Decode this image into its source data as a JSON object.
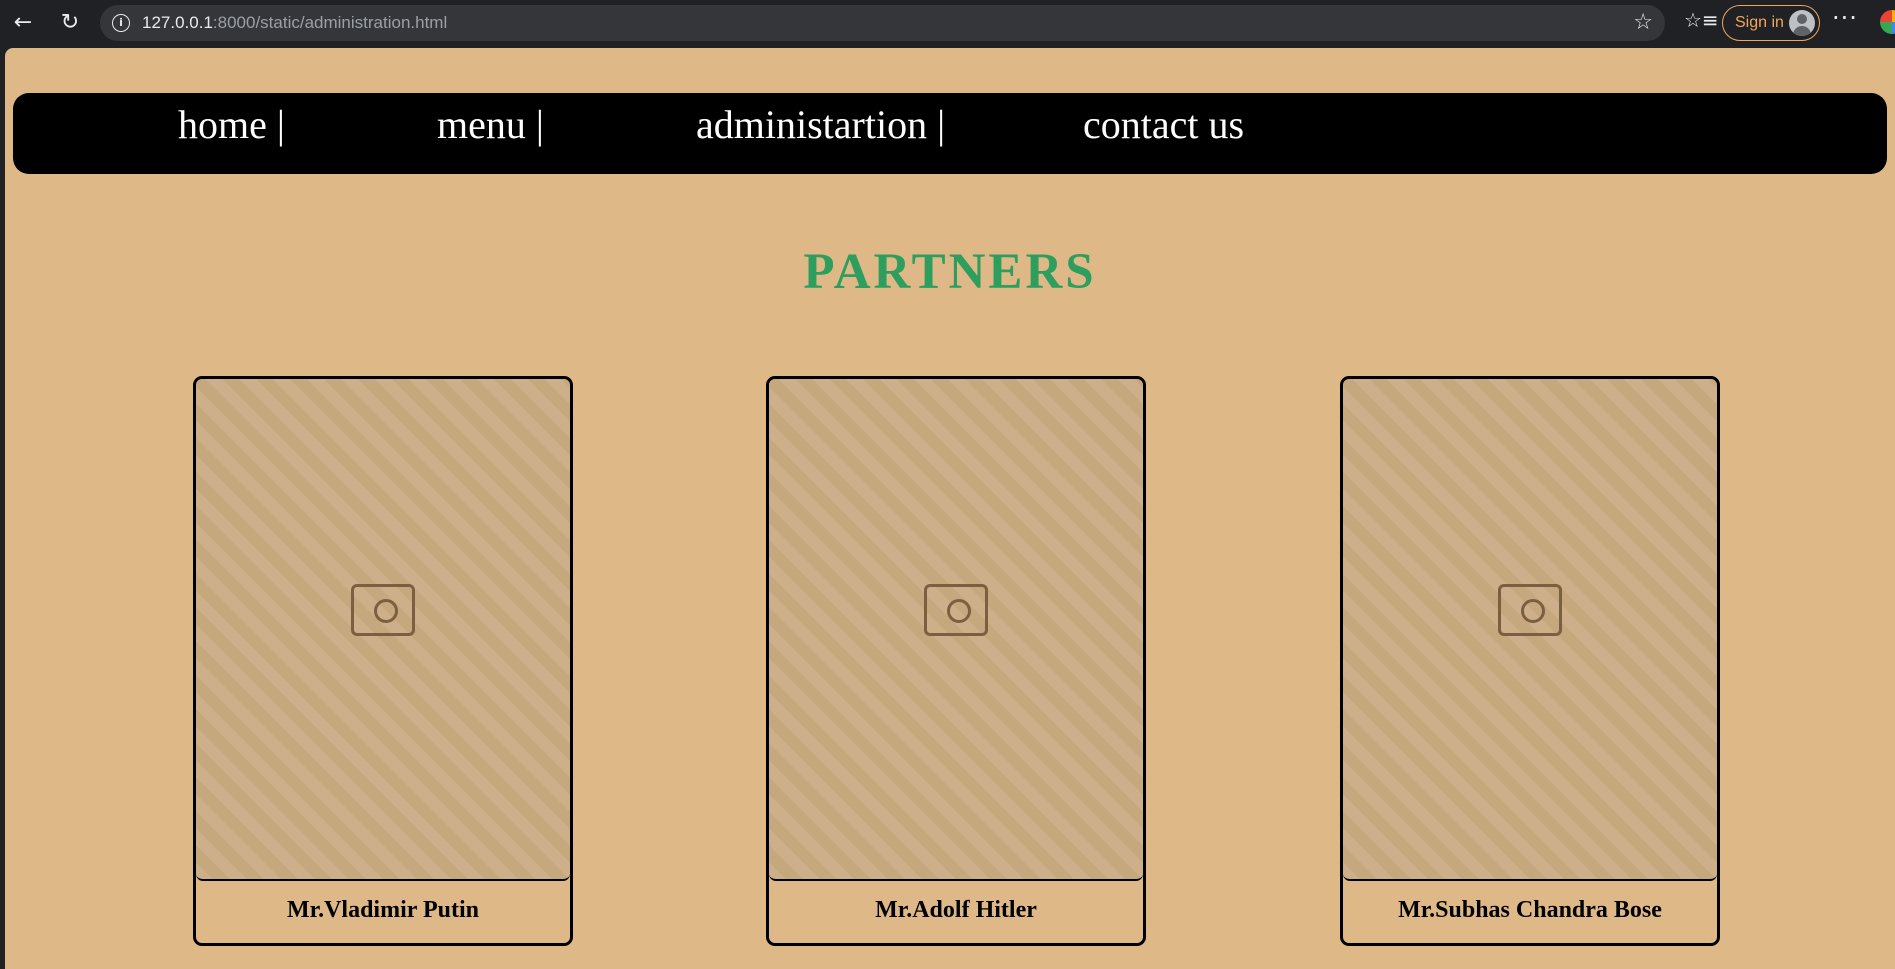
{
  "browser": {
    "url_host": "127.0.0.1",
    "url_rest": ":8000/static/administration.html",
    "signin_label": "Sign in",
    "more_label": "···"
  },
  "nav": {
    "items": [
      {
        "label": "home |"
      },
      {
        "label": "menu |"
      },
      {
        "label": "administartion |"
      },
      {
        "label": "contact us"
      }
    ]
  },
  "page": {
    "title": "PARTNERS"
  },
  "partners": [
    {
      "name": "Mr.Vladimir Putin"
    },
    {
      "name": "Mr.Adolf Hitler"
    },
    {
      "name": "Mr.Subhas Chandra Bose"
    }
  ],
  "colors": {
    "page_background": "#deb887",
    "nav_background": "#000000",
    "title_green": "#2e9e5e"
  }
}
